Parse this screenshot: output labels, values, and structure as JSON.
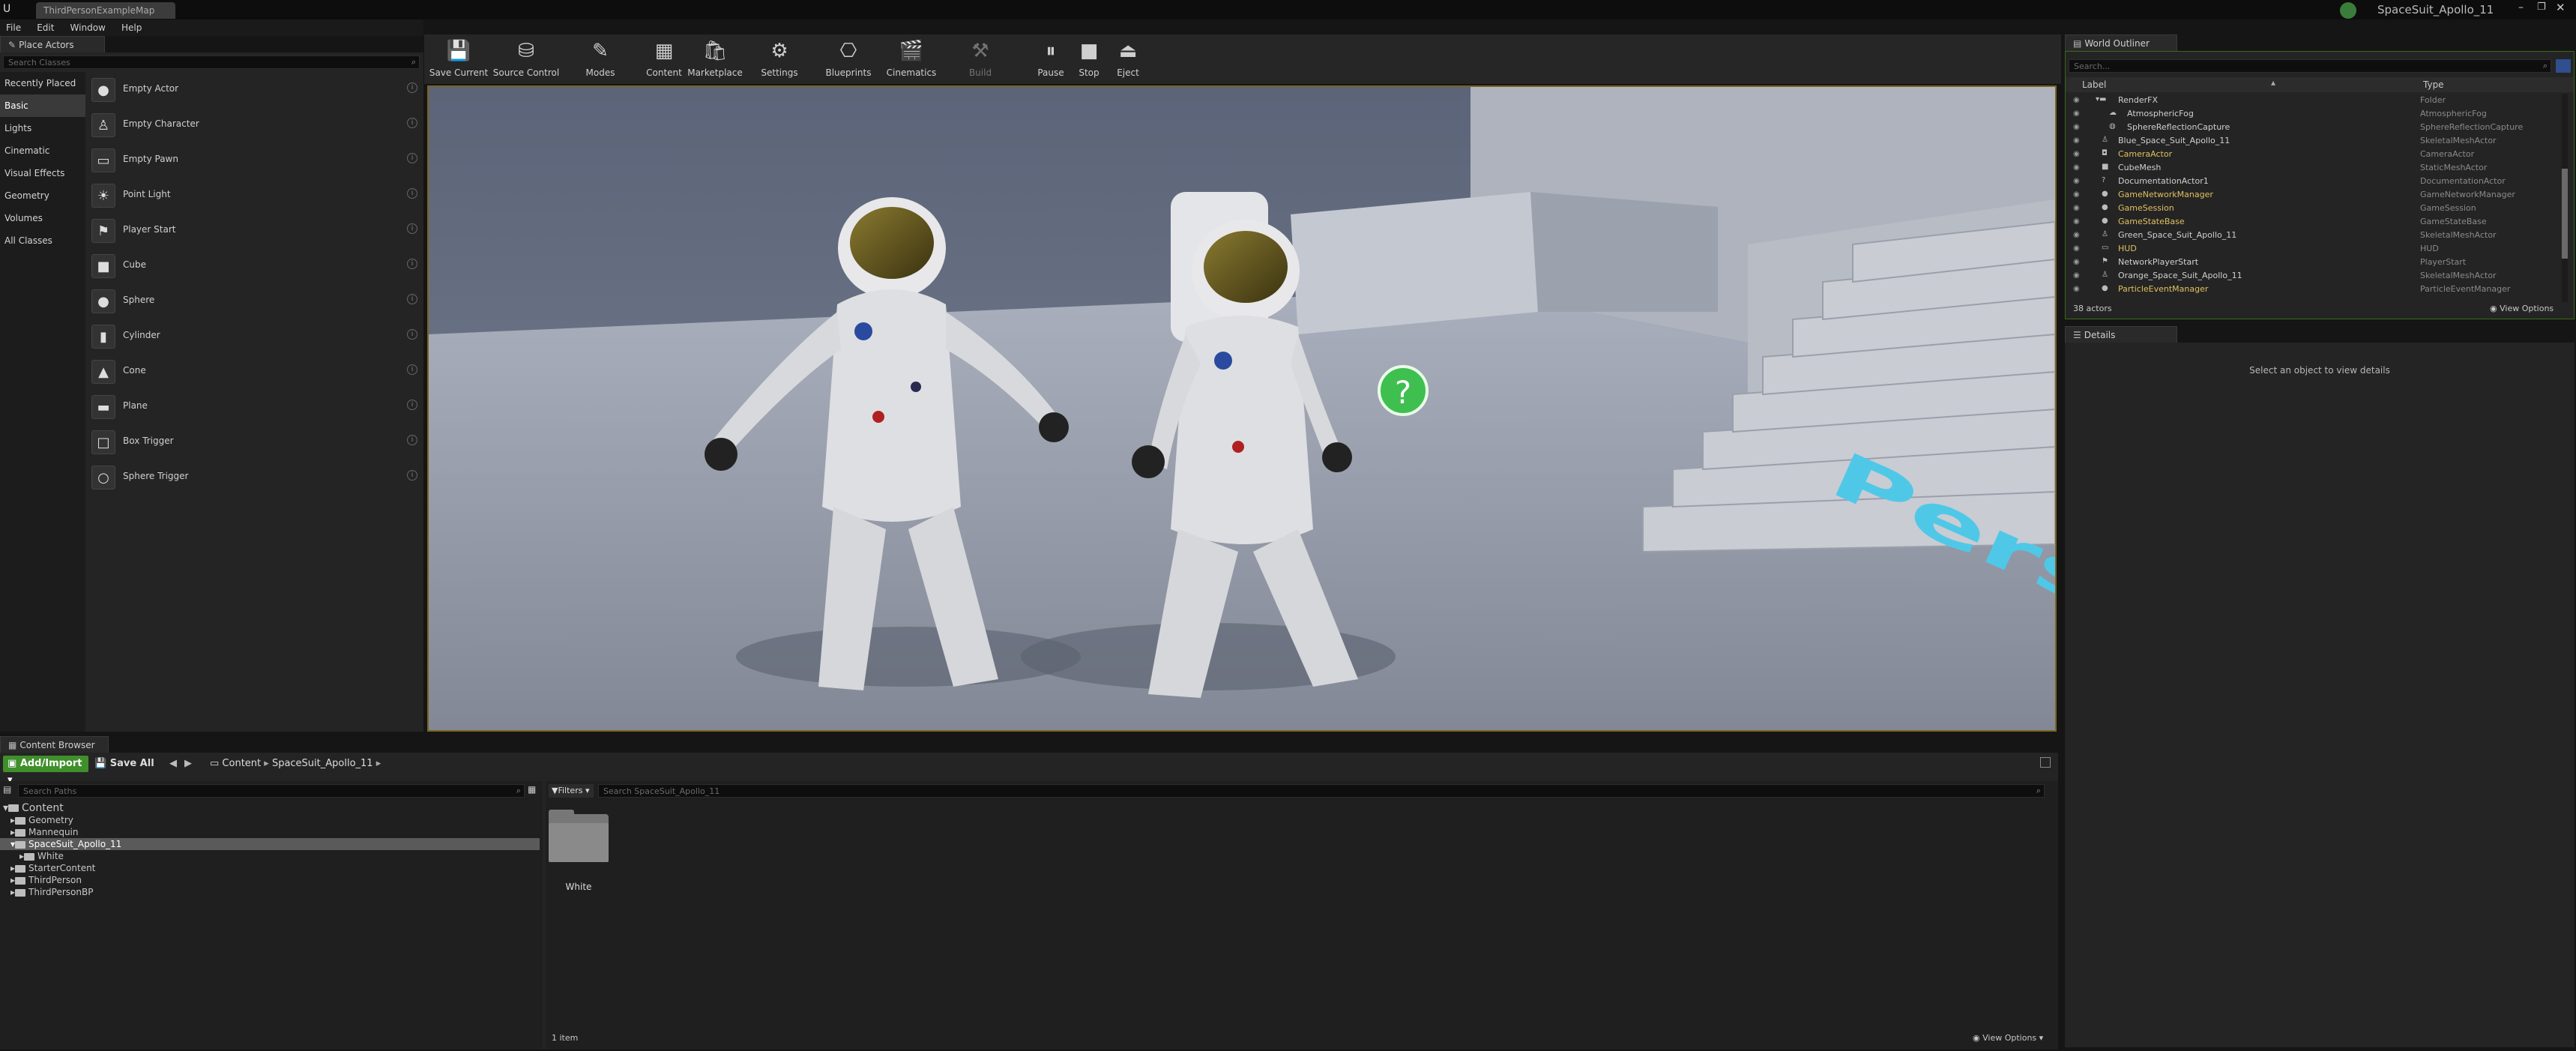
{
  "window": {
    "tab_title": "ThirdPersonExampleMap",
    "project_name": "SpaceSuit_Apollo_11"
  },
  "menu": [
    "File",
    "Edit",
    "Window",
    "Help"
  ],
  "place_actors": {
    "tab_label": "Place Actors",
    "search_placeholder": "Search Classes",
    "categories": [
      "Recently Placed",
      "Basic",
      "Lights",
      "Cinematic",
      "Visual Effects",
      "Geometry",
      "Volumes",
      "All Classes"
    ],
    "selected_category": "Basic",
    "items": [
      "Empty Actor",
      "Empty Character",
      "Empty Pawn",
      "Point Light",
      "Player Start",
      "Cube",
      "Sphere",
      "Cylinder",
      "Cone",
      "Plane",
      "Box Trigger",
      "Sphere Trigger"
    ]
  },
  "toolbar": [
    {
      "label": "Save Current",
      "icon": "save-icon"
    },
    {
      "label": "Source Control",
      "icon": "source-control-icon"
    },
    {
      "label": "Modes",
      "icon": "modes-icon"
    },
    {
      "label": "Content",
      "icon": "content-icon"
    },
    {
      "label": "Marketplace",
      "icon": "marketplace-icon"
    },
    {
      "label": "Settings",
      "icon": "settings-icon"
    },
    {
      "label": "Blueprints",
      "icon": "blueprints-icon"
    },
    {
      "label": "Cinematics",
      "icon": "cinematics-icon"
    },
    {
      "label": "Build",
      "icon": "build-icon"
    },
    {
      "label": "Pause",
      "icon": "pause-icon"
    },
    {
      "label": "Stop",
      "icon": "stop-icon"
    },
    {
      "label": "Eject",
      "icon": "eject-icon"
    }
  ],
  "viewport": {
    "floor_text": "Person"
  },
  "world_outliner": {
    "tab_label": "World Outliner",
    "search_placeholder": "Search...",
    "col_label": "Label",
    "col_type": "Type",
    "rows": [
      {
        "name": "RenderFX",
        "type": "Folder",
        "highlight": false
      },
      {
        "name": "AtmosphericFog",
        "type": "AtmosphericFog",
        "highlight": false
      },
      {
        "name": "SphereReflectionCapture",
        "type": "SphereReflectionCapture",
        "highlight": false
      },
      {
        "name": "Blue_Space_Suit_Apollo_11",
        "type": "SkeletalMeshActor",
        "highlight": false
      },
      {
        "name": "CameraActor",
        "type": "CameraActor",
        "highlight": true
      },
      {
        "name": "CubeMesh",
        "type": "StaticMeshActor",
        "highlight": false
      },
      {
        "name": "DocumentationActor1",
        "type": "DocumentationActor",
        "highlight": false
      },
      {
        "name": "GameNetworkManager",
        "type": "GameNetworkManager",
        "highlight": true
      },
      {
        "name": "GameSession",
        "type": "GameSession",
        "highlight": true
      },
      {
        "name": "GameStateBase",
        "type": "GameStateBase",
        "highlight": true
      },
      {
        "name": "Green_Space_Suit_Apollo_11",
        "type": "SkeletalMeshActor",
        "highlight": false
      },
      {
        "name": "HUD",
        "type": "HUD",
        "highlight": true
      },
      {
        "name": "NetworkPlayerStart",
        "type": "PlayerStart",
        "highlight": false
      },
      {
        "name": "Orange_Space_Suit_Apollo_11",
        "type": "SkeletalMeshActor",
        "highlight": false
      },
      {
        "name": "ParticleEventManager",
        "type": "ParticleEventManager",
        "highlight": true
      }
    ],
    "actor_count": "38 actors",
    "view_options": "View Options"
  },
  "details": {
    "tab_label": "Details",
    "empty_message": "Select an object to view details"
  },
  "content_browser": {
    "tab_label": "Content Browser",
    "add_import": "Add/Import",
    "save_all": "Save All",
    "breadcrumb": [
      "Content",
      "SpaceSuit_Apollo_11"
    ],
    "search_paths_placeholder": "Search Paths",
    "filters_label": "Filters",
    "search_placeholder": "Search SpaceSuit_Apollo_11",
    "tree": [
      {
        "label": "Content",
        "depth": 0,
        "selected": false
      },
      {
        "label": "Geometry",
        "depth": 1,
        "selected": false
      },
      {
        "label": "Mannequin",
        "depth": 1,
        "selected": false
      },
      {
        "label": "SpaceSuit_Apollo_11",
        "depth": 1,
        "selected": true
      },
      {
        "label": "White",
        "depth": 2,
        "selected": false
      },
      {
        "label": "StarterContent",
        "depth": 1,
        "selected": false
      },
      {
        "label": "ThirdPerson",
        "depth": 1,
        "selected": false
      },
      {
        "label": "ThirdPersonBP",
        "depth": 1,
        "selected": false
      }
    ],
    "assets": [
      {
        "label": "White"
      }
    ],
    "item_count": "1 item",
    "view_options": "View Options"
  }
}
